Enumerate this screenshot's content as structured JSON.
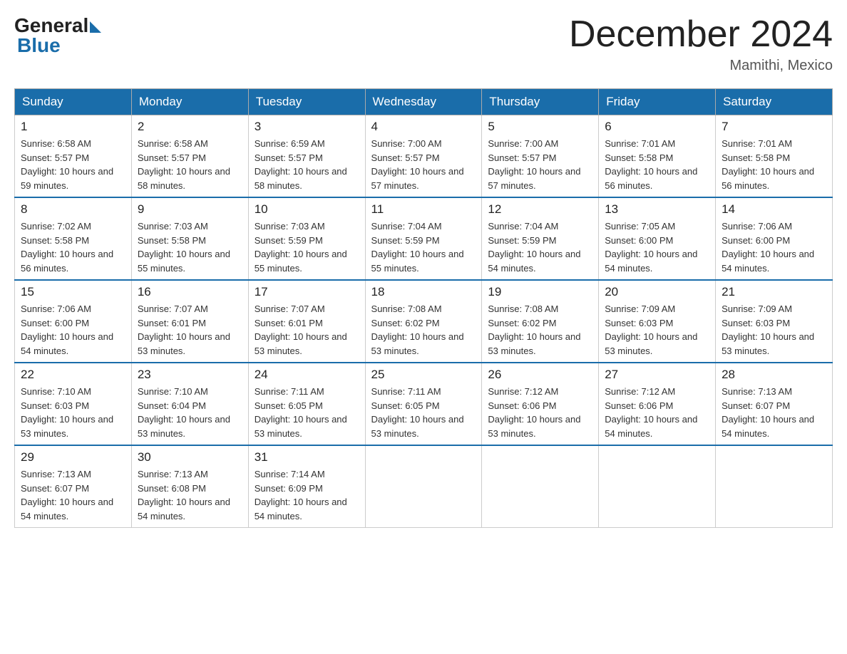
{
  "logo": {
    "general_text": "General",
    "blue_text": "Blue"
  },
  "title": "December 2024",
  "location": "Mamithi, Mexico",
  "weekdays": [
    "Sunday",
    "Monday",
    "Tuesday",
    "Wednesday",
    "Thursday",
    "Friday",
    "Saturday"
  ],
  "weeks": [
    [
      {
        "day": "1",
        "sunrise": "6:58 AM",
        "sunset": "5:57 PM",
        "daylight": "10 hours and 59 minutes."
      },
      {
        "day": "2",
        "sunrise": "6:58 AM",
        "sunset": "5:57 PM",
        "daylight": "10 hours and 58 minutes."
      },
      {
        "day": "3",
        "sunrise": "6:59 AM",
        "sunset": "5:57 PM",
        "daylight": "10 hours and 58 minutes."
      },
      {
        "day": "4",
        "sunrise": "7:00 AM",
        "sunset": "5:57 PM",
        "daylight": "10 hours and 57 minutes."
      },
      {
        "day": "5",
        "sunrise": "7:00 AM",
        "sunset": "5:57 PM",
        "daylight": "10 hours and 57 minutes."
      },
      {
        "day": "6",
        "sunrise": "7:01 AM",
        "sunset": "5:58 PM",
        "daylight": "10 hours and 56 minutes."
      },
      {
        "day": "7",
        "sunrise": "7:01 AM",
        "sunset": "5:58 PM",
        "daylight": "10 hours and 56 minutes."
      }
    ],
    [
      {
        "day": "8",
        "sunrise": "7:02 AM",
        "sunset": "5:58 PM",
        "daylight": "10 hours and 56 minutes."
      },
      {
        "day": "9",
        "sunrise": "7:03 AM",
        "sunset": "5:58 PM",
        "daylight": "10 hours and 55 minutes."
      },
      {
        "day": "10",
        "sunrise": "7:03 AM",
        "sunset": "5:59 PM",
        "daylight": "10 hours and 55 minutes."
      },
      {
        "day": "11",
        "sunrise": "7:04 AM",
        "sunset": "5:59 PM",
        "daylight": "10 hours and 55 minutes."
      },
      {
        "day": "12",
        "sunrise": "7:04 AM",
        "sunset": "5:59 PM",
        "daylight": "10 hours and 54 minutes."
      },
      {
        "day": "13",
        "sunrise": "7:05 AM",
        "sunset": "6:00 PM",
        "daylight": "10 hours and 54 minutes."
      },
      {
        "day": "14",
        "sunrise": "7:06 AM",
        "sunset": "6:00 PM",
        "daylight": "10 hours and 54 minutes."
      }
    ],
    [
      {
        "day": "15",
        "sunrise": "7:06 AM",
        "sunset": "6:00 PM",
        "daylight": "10 hours and 54 minutes."
      },
      {
        "day": "16",
        "sunrise": "7:07 AM",
        "sunset": "6:01 PM",
        "daylight": "10 hours and 53 minutes."
      },
      {
        "day": "17",
        "sunrise": "7:07 AM",
        "sunset": "6:01 PM",
        "daylight": "10 hours and 53 minutes."
      },
      {
        "day": "18",
        "sunrise": "7:08 AM",
        "sunset": "6:02 PM",
        "daylight": "10 hours and 53 minutes."
      },
      {
        "day": "19",
        "sunrise": "7:08 AM",
        "sunset": "6:02 PM",
        "daylight": "10 hours and 53 minutes."
      },
      {
        "day": "20",
        "sunrise": "7:09 AM",
        "sunset": "6:03 PM",
        "daylight": "10 hours and 53 minutes."
      },
      {
        "day": "21",
        "sunrise": "7:09 AM",
        "sunset": "6:03 PM",
        "daylight": "10 hours and 53 minutes."
      }
    ],
    [
      {
        "day": "22",
        "sunrise": "7:10 AM",
        "sunset": "6:03 PM",
        "daylight": "10 hours and 53 minutes."
      },
      {
        "day": "23",
        "sunrise": "7:10 AM",
        "sunset": "6:04 PM",
        "daylight": "10 hours and 53 minutes."
      },
      {
        "day": "24",
        "sunrise": "7:11 AM",
        "sunset": "6:05 PM",
        "daylight": "10 hours and 53 minutes."
      },
      {
        "day": "25",
        "sunrise": "7:11 AM",
        "sunset": "6:05 PM",
        "daylight": "10 hours and 53 minutes."
      },
      {
        "day": "26",
        "sunrise": "7:12 AM",
        "sunset": "6:06 PM",
        "daylight": "10 hours and 53 minutes."
      },
      {
        "day": "27",
        "sunrise": "7:12 AM",
        "sunset": "6:06 PM",
        "daylight": "10 hours and 54 minutes."
      },
      {
        "day": "28",
        "sunrise": "7:13 AM",
        "sunset": "6:07 PM",
        "daylight": "10 hours and 54 minutes."
      }
    ],
    [
      {
        "day": "29",
        "sunrise": "7:13 AM",
        "sunset": "6:07 PM",
        "daylight": "10 hours and 54 minutes."
      },
      {
        "day": "30",
        "sunrise": "7:13 AM",
        "sunset": "6:08 PM",
        "daylight": "10 hours and 54 minutes."
      },
      {
        "day": "31",
        "sunrise": "7:14 AM",
        "sunset": "6:09 PM",
        "daylight": "10 hours and 54 minutes."
      },
      null,
      null,
      null,
      null
    ]
  ]
}
